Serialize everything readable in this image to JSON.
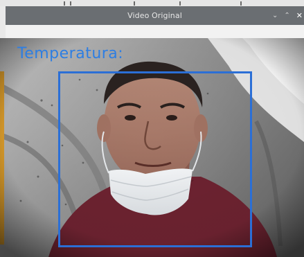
{
  "window": {
    "title": "Video Original",
    "controls": {
      "minimize_glyph": "⌄",
      "maximize_glyph": "⌃",
      "close_glyph": "✕"
    }
  },
  "video": {
    "overlay_label": "Temperatura:",
    "overlay_color": "#2d7ee3",
    "detection_box_color": "#2b6fd6"
  }
}
